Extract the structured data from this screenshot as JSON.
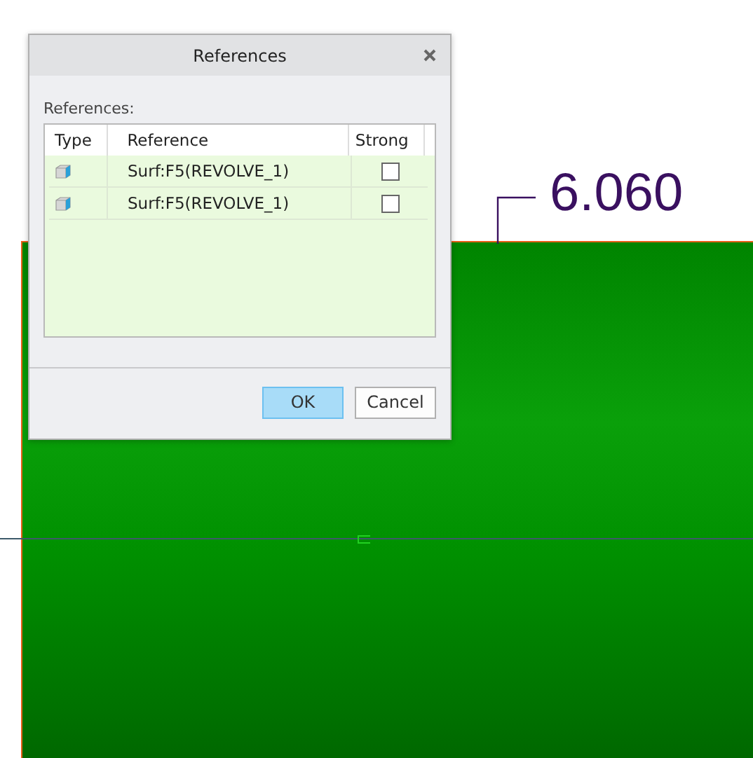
{
  "dimension": {
    "value": "6.060"
  },
  "dialog": {
    "title": "References",
    "list_label": "References:",
    "table": {
      "columns": [
        "Type",
        "Reference",
        "Strong"
      ],
      "rows": [
        {
          "reference": "Surf:F5(REVOLVE_1)",
          "strong": false
        },
        {
          "reference": "Surf:F5(REVOLVE_1)",
          "strong": false
        }
      ]
    },
    "buttons": [
      {
        "label": "OK",
        "default": true
      },
      {
        "label": "Cancel",
        "default": false
      }
    ]
  }
}
